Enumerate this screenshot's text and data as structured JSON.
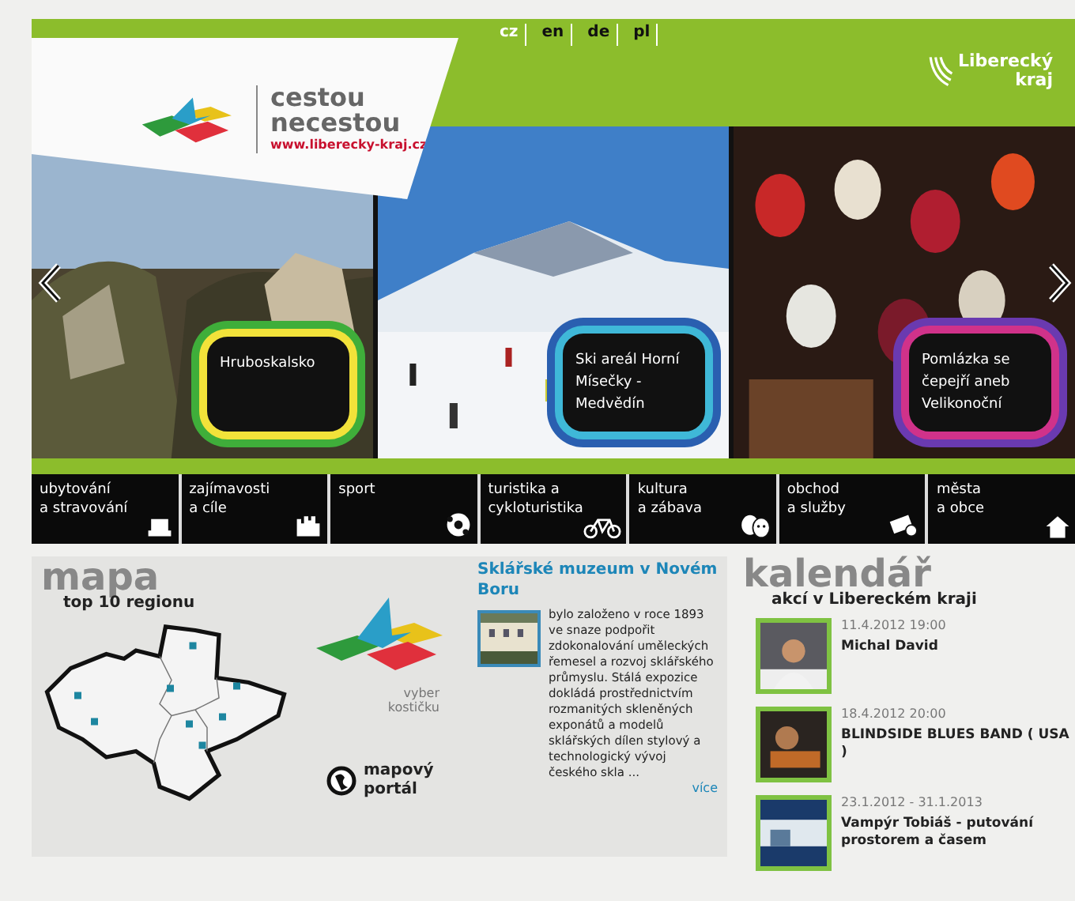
{
  "languages": [
    {
      "label": "cz",
      "selected": true
    },
    {
      "label": "en",
      "selected": false
    },
    {
      "label": "de",
      "selected": false
    },
    {
      "label": "pl",
      "selected": false
    }
  ],
  "logo": {
    "title": "cestou",
    "subtitle": "necestou",
    "url": "www.liberecky-kraj.cz"
  },
  "brand": {
    "line1": "Liberecký",
    "line2": "kraj"
  },
  "slides": [
    {
      "kind": "rocks",
      "caption": "Hruboskalsko"
    },
    {
      "kind": "ski",
      "caption": "Ski areál Horní Mísečky - Medvědín"
    },
    {
      "kind": "eggs",
      "caption": "Pomlázka se čepejří aneb Velikonoční"
    }
  ],
  "nav": [
    {
      "label": "ubytování\na stravování"
    },
    {
      "label": "zajímavosti\na cíle"
    },
    {
      "label": "sport"
    },
    {
      "label": "turistika a\ncykloturistika"
    },
    {
      "label": "kultura\na zábava"
    },
    {
      "label": "obchod\na služby"
    },
    {
      "label": "města\na obce"
    }
  ],
  "map": {
    "title": "mapa",
    "subtitle": "top 10 regionu",
    "pick_hint": "vyber\nkostičku",
    "portal": "mapový\nportál"
  },
  "article": {
    "title": "Sklářské muzeum v Novém Boru",
    "text": "bylo založeno v roce 1893 ve snaze podpořit zdokonalování uměleckých řemesel a rozvoj sklářského průmyslu. Stálá expozice dokládá prostřednictvím rozmanitých skleněných exponátů a modelů sklářských dílen stylový a technologický vývoj českého skla ...",
    "more": "více"
  },
  "calendar": {
    "title": "kalendář",
    "subtitle": "akcí v Libereckém kraji",
    "events": [
      {
        "date": "11.4.2012 19:00",
        "name": "Michal David"
      },
      {
        "date": "18.4.2012 20:00",
        "name": "BLINDSIDE BLUES BAND ( USA )"
      },
      {
        "date": "23.1.2012 - 31.1.2013",
        "name": "Vampýr Tobiáš - putování prostorem a časem"
      }
    ]
  }
}
